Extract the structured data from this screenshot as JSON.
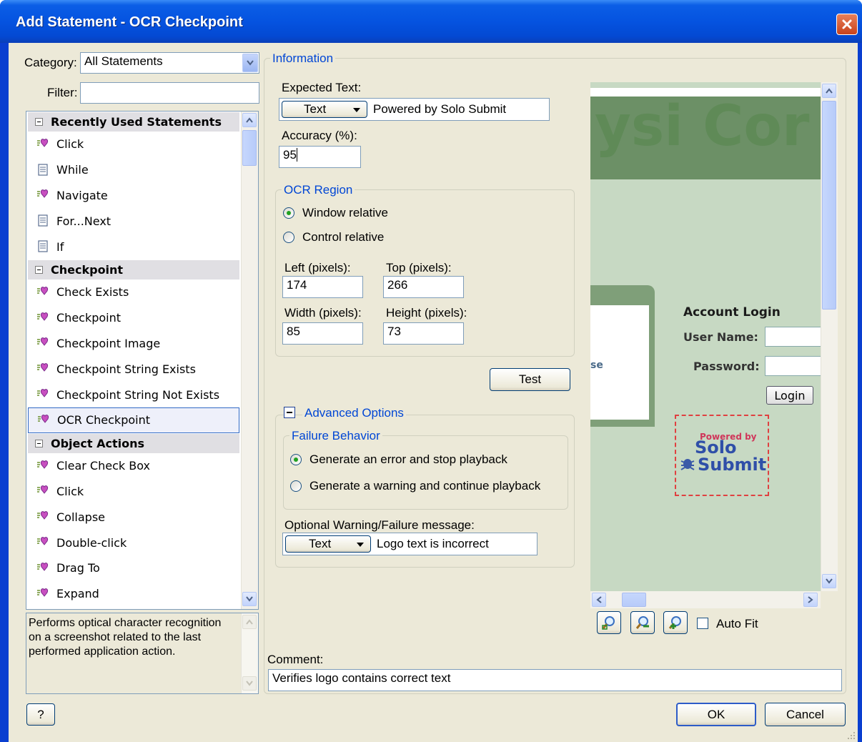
{
  "window": {
    "title": "Add Statement - OCR Checkpoint"
  },
  "left": {
    "category_label": "Category:",
    "category_value": "All Statements",
    "filter_label": "Filter:",
    "filter_value": "",
    "sections": [
      {
        "title": "Recently Used Statements",
        "items": [
          {
            "label": "Click",
            "icon": "action-icon"
          },
          {
            "label": "While",
            "icon": "document-icon"
          },
          {
            "label": "Navigate",
            "icon": "action-icon"
          },
          {
            "label": "For...Next",
            "icon": "document-icon"
          },
          {
            "label": "If",
            "icon": "document-icon"
          }
        ]
      },
      {
        "title": "Checkpoint",
        "items": [
          {
            "label": "Check Exists",
            "icon": "action-icon"
          },
          {
            "label": "Checkpoint",
            "icon": "action-icon"
          },
          {
            "label": "Checkpoint Image",
            "icon": "action-icon"
          },
          {
            "label": "Checkpoint String Exists",
            "icon": "action-icon"
          },
          {
            "label": "Checkpoint String Not Exists",
            "icon": "action-icon"
          },
          {
            "label": "OCR Checkpoint",
            "icon": "action-icon",
            "selected": true
          }
        ]
      },
      {
        "title": "Object Actions",
        "items": [
          {
            "label": "Clear Check Box",
            "icon": "action-icon"
          },
          {
            "label": "Click",
            "icon": "action-icon"
          },
          {
            "label": "Collapse",
            "icon": "action-icon"
          },
          {
            "label": "Double-click",
            "icon": "action-icon"
          },
          {
            "label": "Drag To",
            "icon": "action-icon"
          },
          {
            "label": "Expand",
            "icon": "action-icon"
          }
        ]
      }
    ],
    "description": "Performs optical character recognition on a screenshot related to the last performed application action."
  },
  "info": {
    "legend": "Information",
    "expected_text_label": "Expected Text:",
    "expected_type": "Text",
    "expected_value": "Powered by Solo Submit",
    "accuracy_label": "Accuracy (%):",
    "accuracy_value": "95",
    "ocr_region": {
      "legend": "OCR Region",
      "window_relative": "Window relative",
      "control_relative": "Control relative",
      "selected": "window_relative",
      "left_label": "Left (pixels):",
      "left_value": "174",
      "top_label": "Top (pixels):",
      "top_value": "266",
      "width_label": "Width (pixels):",
      "width_value": "85",
      "height_label": "Height (pixels):",
      "height_value": "73"
    },
    "test_button": "Test",
    "advanced": {
      "legend": "Advanced Options",
      "failure_legend": "Failure Behavior",
      "option_error": "Generate an error and stop playback",
      "option_warning": "Generate a warning and continue playback",
      "selected": "option_error",
      "message_label": "Optional Warning/Failure message:",
      "message_type": "Text",
      "message_value": "Logo text is incorrect"
    }
  },
  "preview": {
    "banner_text": "ysi Cor",
    "account_login": "Account Login",
    "user_name_label": "User Name:",
    "password_label": "Password:",
    "login_button": "Login",
    "fragment_text": "se",
    "logo": {
      "powered_by": "Powered by",
      "solo": "Solo",
      "submit": "Submit"
    },
    "auto_fit_label": "Auto Fit"
  },
  "comment": {
    "label": "Comment:",
    "value": "Verifies logo contains correct text"
  },
  "buttons": {
    "help": "?",
    "ok": "OK",
    "cancel": "Cancel"
  },
  "colors": {
    "title_bar": "#0553e0",
    "dialog_bg": "#ece9d8",
    "legend_blue": "#0046d5",
    "preview_green": "#c7d9c3",
    "logo_green": "#5f8a57",
    "selection": "#316ac5"
  }
}
